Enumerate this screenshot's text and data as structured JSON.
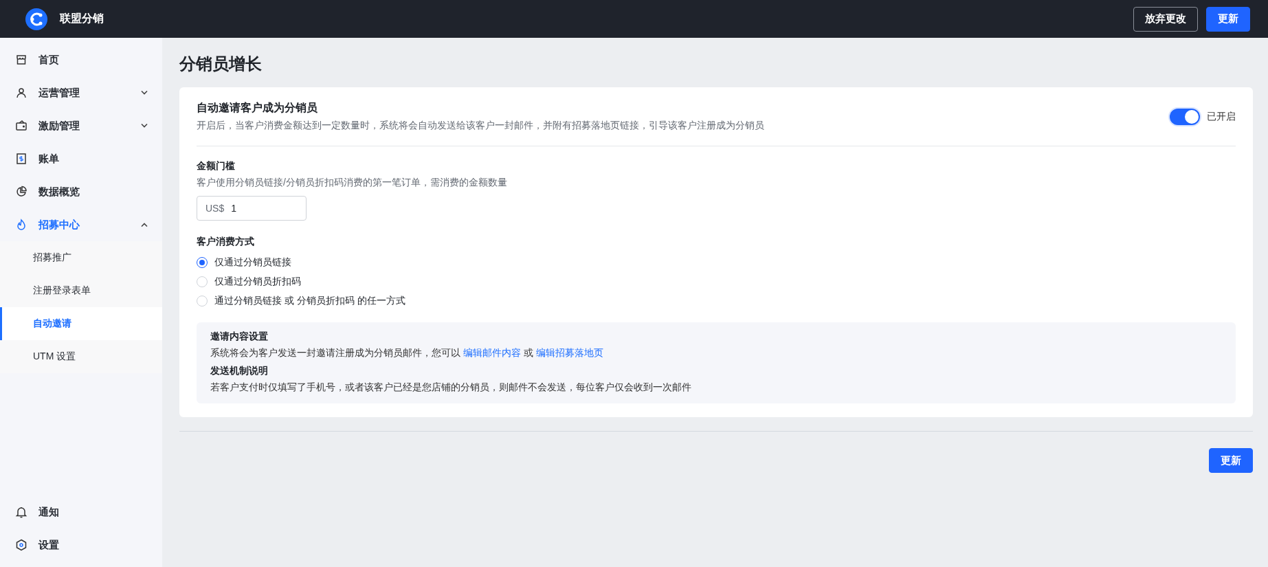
{
  "app": {
    "title": "联盟分销"
  },
  "header_buttons": [
    {
      "label": "放弃更改",
      "kind": "secondary"
    },
    {
      "label": "更新",
      "kind": "primary"
    }
  ],
  "sidebar": {
    "items": [
      {
        "label": "首页",
        "selected": false
      },
      {
        "label": "运营管理",
        "selected": false,
        "expanded": false
      },
      {
        "label": "激励管理",
        "selected": false,
        "expanded": false
      },
      {
        "label": "账单",
        "selected": false
      },
      {
        "label": "数据概览",
        "selected": false
      },
      {
        "label": "招募中心",
        "selected": true,
        "expanded": true,
        "children": [
          {
            "label": "招募推广",
            "selected": false
          },
          {
            "label": "注册登录表单",
            "selected": false
          },
          {
            "label": "自动邀请",
            "selected": true
          },
          {
            "label": "UTM 设置",
            "selected": false
          }
        ]
      }
    ],
    "bottom_items": [
      {
        "label": "通知"
      },
      {
        "label": "设置"
      }
    ]
  },
  "page": {
    "title": "分销员增长",
    "auto_invite": {
      "title": "自动邀请客户成为分销员",
      "description": "开启后，当客户消费金额达到一定数量时，系统将会自动发送给该客户一封邮件，并附有招募落地页链接，引导该客户注册成为分销员",
      "on": true,
      "status": "已开启"
    },
    "threshold": {
      "label": "金额门槛",
      "hint": "客户使用分销员链接/分销员折扣码消费的第一笔订单，需消费的金额数量",
      "prefix": "US$",
      "value": "1"
    },
    "spend_method": {
      "label": "客户消费方式",
      "options": [
        {
          "label": "仅通过分销员链接",
          "selected": true
        },
        {
          "label": "仅通过分销员折扣码",
          "selected": false
        },
        {
          "label": "通过分销员链接 或 分销员折扣码 的任一方式",
          "selected": false
        }
      ]
    },
    "info": {
      "sections": [
        {
          "title": "邀请内容设置",
          "segments": [
            {
              "kind": "text",
              "text": "系统将会为客户发送一封邀请注册成为分销员邮件，您可以 "
            },
            {
              "kind": "link",
              "text": "编辑邮件内容"
            },
            {
              "kind": "text",
              "text": " 或 "
            },
            {
              "kind": "link",
              "text": "编辑招募落地页"
            }
          ]
        },
        {
          "title": "发送机制说明",
          "segments": [
            {
              "kind": "text",
              "text": "若客户支付时仅填写了手机号，或者该客户已经是您店铺的分销员，则邮件不会发送，每位客户仅会收到一次邮件"
            }
          ]
        }
      ]
    },
    "footer_button": {
      "label": "更新"
    }
  }
}
